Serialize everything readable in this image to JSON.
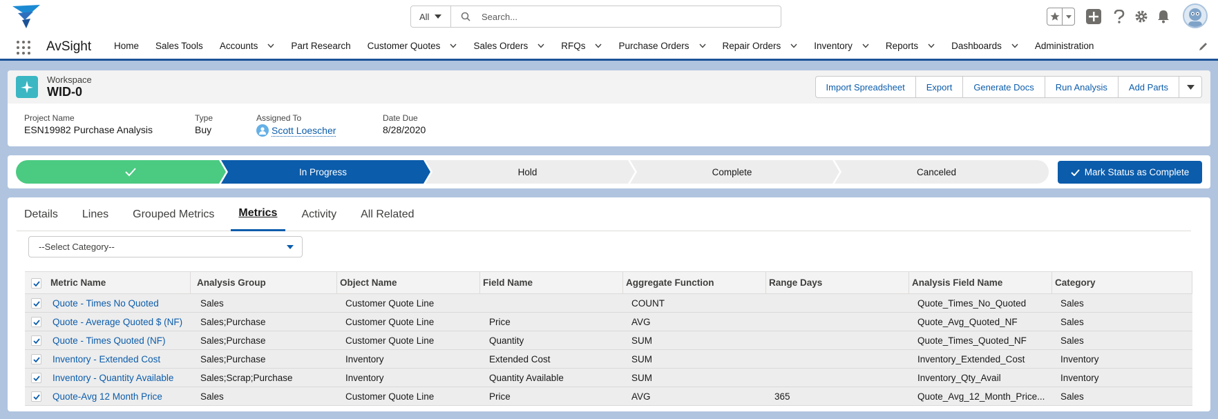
{
  "header": {
    "search_scope": "All",
    "search_placeholder": "Search...",
    "icons": [
      "star-icon",
      "add-icon",
      "help-icon",
      "setup-gear-icon",
      "notification-bell-icon",
      "avatar"
    ]
  },
  "nav": {
    "app_name": "AvSight",
    "items": [
      {
        "label": "Home",
        "dropdown": false
      },
      {
        "label": "Sales Tools",
        "dropdown": false
      },
      {
        "label": "Accounts",
        "dropdown": true
      },
      {
        "label": "Part Research",
        "dropdown": false
      },
      {
        "label": "Customer Quotes",
        "dropdown": true
      },
      {
        "label": "Sales Orders",
        "dropdown": true
      },
      {
        "label": "RFQs",
        "dropdown": true
      },
      {
        "label": "Purchase Orders",
        "dropdown": true
      },
      {
        "label": "Repair Orders",
        "dropdown": true
      },
      {
        "label": "Inventory",
        "dropdown": true
      },
      {
        "label": "Reports",
        "dropdown": true
      },
      {
        "label": "Dashboards",
        "dropdown": true
      },
      {
        "label": "Administration",
        "dropdown": false
      }
    ]
  },
  "record": {
    "object_type": "Workspace",
    "title": "WID-0",
    "actions": [
      "Import Spreadsheet",
      "Export",
      "Generate Docs",
      "Run Analysis",
      "Add Parts"
    ],
    "fields": {
      "project_name_label": "Project Name",
      "project_name": "ESN19982 Purchase Analysis",
      "type_label": "Type",
      "type": "Buy",
      "assigned_label": "Assigned To",
      "assigned": "Scott Loescher",
      "due_label": "Date Due",
      "due": "8/28/2020"
    }
  },
  "path": {
    "stages": [
      {
        "label": "",
        "state": "complete"
      },
      {
        "label": "In Progress",
        "state": "current"
      },
      {
        "label": "Hold",
        "state": "incomplete"
      },
      {
        "label": "Complete",
        "state": "incomplete"
      },
      {
        "label": "Canceled",
        "state": "incomplete"
      }
    ],
    "mark_button": "Mark Status as Complete",
    "colors": {
      "complete": "#4bca81",
      "current": "#0b5cab",
      "incomplete": "#ededed"
    }
  },
  "tabs": [
    "Details",
    "Lines",
    "Grouped Metrics",
    "Metrics",
    "Activity",
    "All Related"
  ],
  "active_tab": "Metrics",
  "category_select": "--Select Category--",
  "table": {
    "columns": [
      "Metric Name",
      "Analysis Group",
      "Object Name",
      "Field Name",
      "Aggregate Function",
      "Range Days",
      "Analysis Field Name",
      "Category"
    ],
    "rows": [
      [
        "Quote - Times No Quoted",
        "Sales",
        "Customer Quote Line",
        "",
        "COUNT",
        "",
        "Quote_Times_No_Quoted",
        "Sales"
      ],
      [
        "Quote - Average Quoted $ (NF)",
        "Sales;Purchase",
        "Customer Quote Line",
        "Price",
        "AVG",
        "",
        "Quote_Avg_Quoted_NF",
        "Sales"
      ],
      [
        "Quote - Times Quoted (NF)",
        "Sales;Purchase",
        "Customer Quote Line",
        "Quantity",
        "SUM",
        "",
        "Quote_Times_Quoted_NF",
        "Sales"
      ],
      [
        "Inventory - Extended Cost",
        "Sales;Purchase",
        "Inventory",
        "Extended Cost",
        "SUM",
        "",
        "Inventory_Extended_Cost",
        "Inventory"
      ],
      [
        "Inventory - Quantity Available",
        "Sales;Scrap;Purchase",
        "Inventory",
        "Quantity Available",
        "SUM",
        "",
        "Inventory_Qty_Avail",
        "Inventory"
      ],
      [
        "Quote-Avg 12 Month Price",
        "Sales",
        "Customer Quote Line",
        "Price",
        "AVG",
        "365",
        "Quote_Avg_12_Month_Price...",
        "Sales"
      ]
    ]
  }
}
